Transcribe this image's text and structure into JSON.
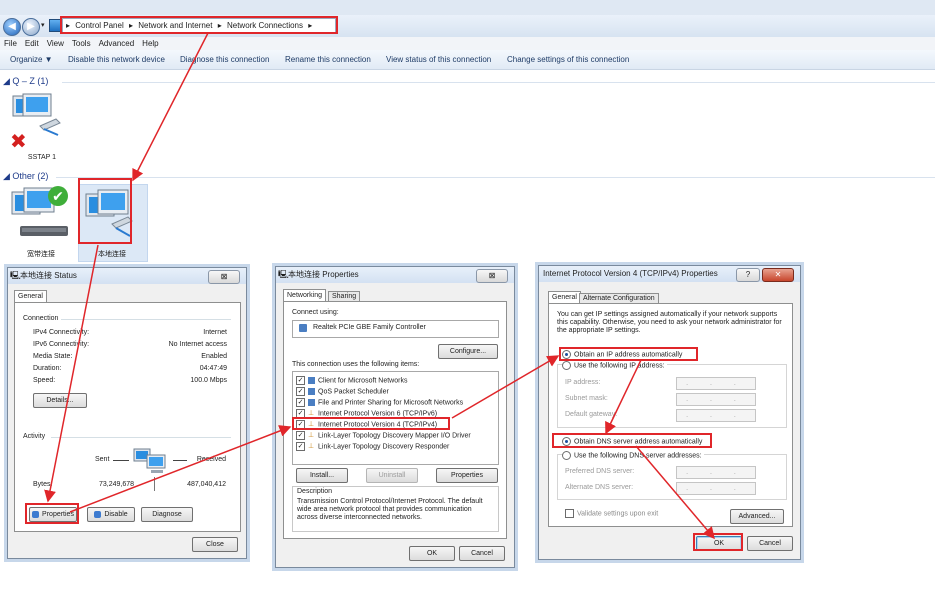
{
  "explorer": {
    "breadcrumb": [
      "Control Panel",
      "Network and Internet",
      "Network Connections"
    ],
    "menu": [
      "File",
      "Edit",
      "View",
      "Tools",
      "Advanced",
      "Help"
    ],
    "commands": [
      "Organize ▼",
      "Disable this network device",
      "Diagnose this connection",
      "Rename this connection",
      "View status of this connection",
      "Change settings of this connection"
    ],
    "groups": {
      "qz": "Q – Z (1)",
      "other": "Other (2)"
    },
    "adapters": {
      "sstap": "SSTAP 1",
      "broadband": "宽带连接",
      "local": "本地连接"
    }
  },
  "status_dialog": {
    "title": "本地连接 Status",
    "close_glyph": "⊠",
    "tab": "General",
    "connection_heading": "Connection",
    "rows": [
      {
        "label": "IPv4 Connectivity:",
        "value": "Internet"
      },
      {
        "label": "IPv6 Connectivity:",
        "value": "No Internet access"
      },
      {
        "label": "Media State:",
        "value": "Enabled"
      },
      {
        "label": "Duration:",
        "value": "04:47:49"
      },
      {
        "label": "Speed:",
        "value": "100.0 Mbps"
      }
    ],
    "details_btn": "Details...",
    "activity_heading": "Activity",
    "sent_label": "Sent",
    "received_label": "Received",
    "bytes_label": "Bytes:",
    "bytes_sent": "73,249,678",
    "bytes_received": "487,040,412",
    "properties_btn": "Properties",
    "disable_btn": "Disable",
    "diagnose_btn": "Diagnose",
    "close_btn": "Close"
  },
  "properties_dialog": {
    "title": "本地连接 Properties",
    "close_glyph": "⊠",
    "tabs": [
      "Networking",
      "Sharing"
    ],
    "connect_using_label": "Connect using:",
    "adapter": "Realtek PCIe GBE Family Controller",
    "configure_btn": "Configure...",
    "items_label": "This connection uses the following items:",
    "items": [
      "Client for Microsoft Networks",
      "QoS Packet Scheduler",
      "File and Printer Sharing for Microsoft Networks",
      "Internet Protocol Version 6 (TCP/IPv6)",
      "Internet Protocol Version 4 (TCP/IPv4)",
      "Link-Layer Topology Discovery Mapper I/O Driver",
      "Link-Layer Topology Discovery Responder"
    ],
    "install_btn": "Install...",
    "uninstall_btn": "Uninstall",
    "properties_btn": "Properties",
    "description_heading": "Description",
    "description": "Transmission Control Protocol/Internet Protocol. The default wide area network protocol that provides communication across diverse interconnected networks.",
    "ok_btn": "OK",
    "cancel_btn": "Cancel"
  },
  "ipv4_dialog": {
    "title": "Internet Protocol Version 4 (TCP/IPv4) Properties",
    "help_glyph": "?",
    "close_glyph": "✕",
    "tabs": [
      "General",
      "Alternate Configuration"
    ],
    "intro": "You can get IP settings assigned automatically if your network supports this capability. Otherwise, you need to ask your network administrator for the appropriate IP settings.",
    "obtain_ip": "Obtain an IP address automatically",
    "use_ip": "Use the following IP address:",
    "ip_fields": [
      "IP address:",
      "Subnet mask:",
      "Default gateway:"
    ],
    "obtain_dns": "Obtain DNS server address automatically",
    "use_dns": "Use the following DNS server addresses:",
    "dns_fields": [
      "Preferred DNS server:",
      "Alternate DNS server:"
    ],
    "ip_placeholder": ". . .",
    "validate": "Validate settings upon exit",
    "advanced_btn": "Advanced...",
    "ok_btn": "OK",
    "cancel_btn": "Cancel"
  },
  "colors": {
    "annotation": "#e0262a",
    "link": "#1e3b66"
  }
}
